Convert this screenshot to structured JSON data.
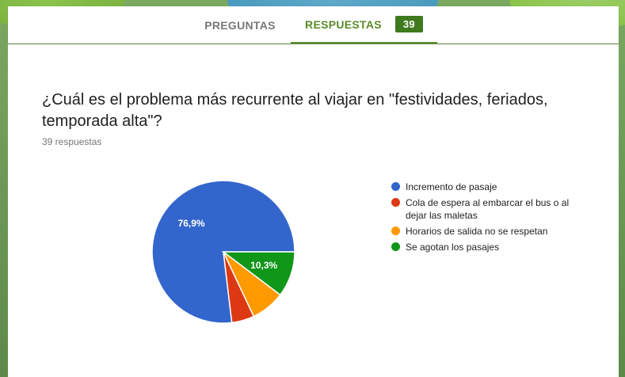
{
  "tabs": {
    "questions_label": "PREGUNTAS",
    "responses_label": "RESPUESTAS",
    "responses_count": "39"
  },
  "question": {
    "title": "¿Cuál es el problema más recurrente al viajar en \"festividades, feriados, temporada alta\"?",
    "response_count_text": "39 respuestas"
  },
  "chart_data": {
    "type": "pie",
    "categories": [
      "Incremento de pasaje",
      "Cola de espera al embarcar el bus o al dejar las maletas",
      "Horarios de salida no se respetan",
      "Se agotan los pasajes"
    ],
    "values": [
      76.9,
      5.1,
      7.7,
      10.3
    ],
    "data_labels": [
      "76,9%",
      "",
      "",
      "10,3%"
    ],
    "colors": [
      "#3366cc",
      "#dc3912",
      "#ff9900",
      "#109618"
    ],
    "legend_position": "right"
  }
}
